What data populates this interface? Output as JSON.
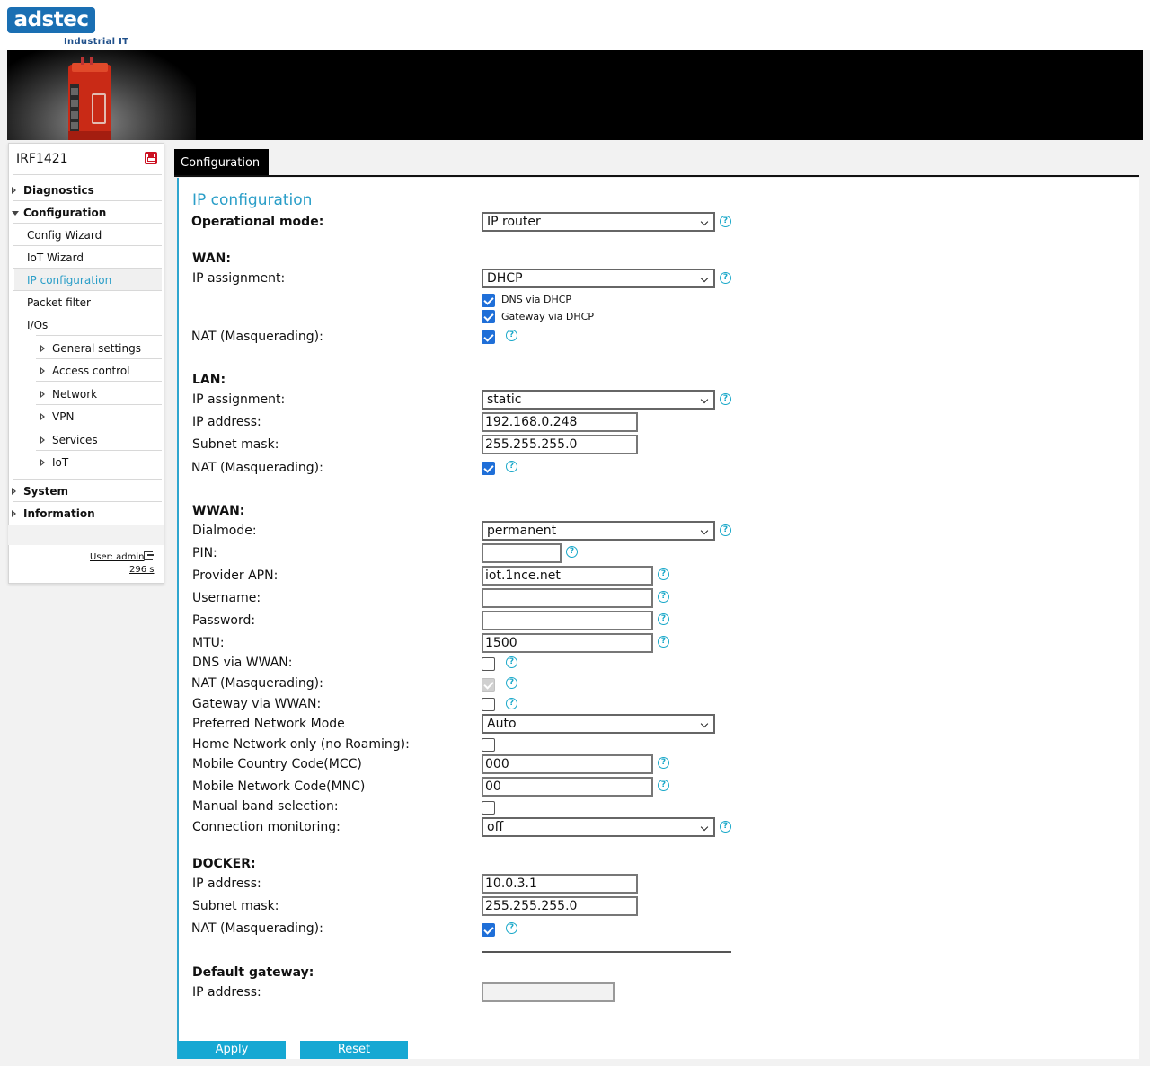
{
  "brand": {
    "logo": "adstec",
    "subtitle": "Industrial IT"
  },
  "sidebar": {
    "device": "IRF1421",
    "items": [
      {
        "label": "Diagnostics"
      },
      {
        "label": "Configuration"
      },
      {
        "label": "Config Wizard"
      },
      {
        "label": "IoT Wizard"
      },
      {
        "label": "IP configuration"
      },
      {
        "label": "Packet filter"
      },
      {
        "label": "I/Os"
      },
      {
        "label": "General settings"
      },
      {
        "label": "Access control"
      },
      {
        "label": "Network"
      },
      {
        "label": "VPN"
      },
      {
        "label": "Services"
      },
      {
        "label": "IoT"
      },
      {
        "label": "System"
      },
      {
        "label": "Information"
      }
    ],
    "user": "User: admin",
    "timer": "296 s"
  },
  "tab": {
    "label": "Configuration"
  },
  "page": {
    "title": "IP configuration",
    "opmode": {
      "label": "Operational mode:",
      "value": "IP router"
    },
    "wan": {
      "heading": "WAN:",
      "ip_assign_label": "IP assignment:",
      "ip_assign_value": "DHCP",
      "dns_dhcp": "DNS via DHCP",
      "gw_dhcp": "Gateway via DHCP",
      "nat_label": "NAT (Masquerading):"
    },
    "lan": {
      "heading": "LAN:",
      "ip_assign_label": "IP assignment:",
      "ip_assign_value": "static",
      "ip_label": "IP address:",
      "ip_value": "192.168.0.248",
      "mask_label": "Subnet mask:",
      "mask_value": "255.255.255.0",
      "nat_label": "NAT (Masquerading):"
    },
    "wwan": {
      "heading": "WWAN:",
      "dialmode_label": "Dialmode:",
      "dialmode_value": "permanent",
      "pin_label": "PIN:",
      "pin_value": "",
      "apn_label": "Provider APN:",
      "apn_value": "iot.1nce.net",
      "user_label": "Username:",
      "user_value": "",
      "pass_label": "Password:",
      "pass_value": "",
      "mtu_label": "MTU:",
      "mtu_value": "1500",
      "dns_label": "DNS via WWAN:",
      "nat_label": "NAT (Masquerading):",
      "gw_label": "Gateway via WWAN:",
      "netmode_label": "Preferred Network Mode",
      "netmode_value": "Auto",
      "home_label": "Home Network only (no Roaming):",
      "mcc_label": "Mobile Country Code(MCC)",
      "mcc_value": "000",
      "mnc_label": "Mobile Network Code(MNC)",
      "mnc_value": "00",
      "band_label": "Manual band selection:",
      "conn_label": "Connection monitoring:",
      "conn_value": "off"
    },
    "docker": {
      "heading": "DOCKER:",
      "ip_label": "IP address:",
      "ip_value": "10.0.3.1",
      "mask_label": "Subnet mask:",
      "mask_value": "255.255.255.0",
      "nat_label": "NAT (Masquerading):"
    },
    "gateway": {
      "heading": "Default gateway:",
      "ip_label": "IP address:",
      "ip_value": ""
    },
    "help_glyph": "?"
  },
  "actions": {
    "apply": "Apply",
    "reset": "Reset"
  },
  "colors": {
    "accent": "#2a9ec8",
    "button": "#16a8d3",
    "checkbox": "#1f6fd8",
    "brand": "#1a6fb3",
    "device_red": "#d8321e"
  }
}
